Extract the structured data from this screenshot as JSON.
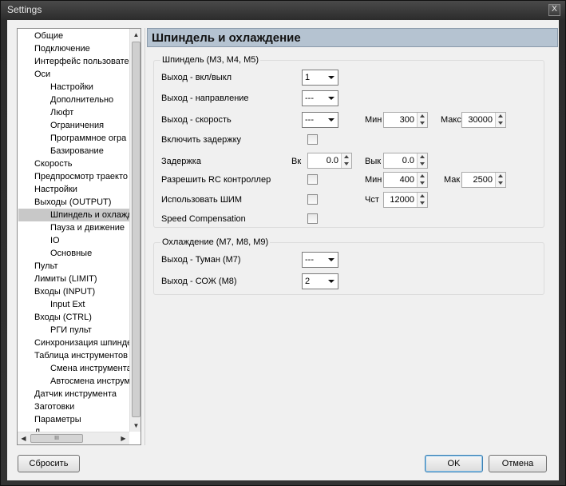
{
  "window": {
    "title": "Settings",
    "close_label": "X"
  },
  "tree": {
    "items": [
      {
        "label": "Общие",
        "level": 0
      },
      {
        "label": "Подключение",
        "level": 0
      },
      {
        "label": "Интерфейс пользовате",
        "level": 0
      },
      {
        "label": "Оси",
        "level": 0
      },
      {
        "label": "Настройки",
        "level": 1
      },
      {
        "label": "Дополнительно",
        "level": 1
      },
      {
        "label": "Люфт",
        "level": 1
      },
      {
        "label": "Ограничения",
        "level": 1
      },
      {
        "label": "Программное огра",
        "level": 1
      },
      {
        "label": "Базирование",
        "level": 1
      },
      {
        "label": "Скорость",
        "level": 0
      },
      {
        "label": "Предпросмотр траекто",
        "level": 0
      },
      {
        "label": "Настройки",
        "level": 0
      },
      {
        "label": "Выходы (OUTPUT)",
        "level": 0
      },
      {
        "label": "Шпиндель и охлажд",
        "level": 1,
        "selected": true
      },
      {
        "label": "Пауза и движение",
        "level": 1
      },
      {
        "label": "IO",
        "level": 1
      },
      {
        "label": "Основные",
        "level": 1
      },
      {
        "label": "Пульт",
        "level": 0
      },
      {
        "label": "Лимиты (LIMIT)",
        "level": 0
      },
      {
        "label": "Входы (INPUT)",
        "level": 0
      },
      {
        "label": "Input Ext",
        "level": 1
      },
      {
        "label": "Входы (CTRL)",
        "level": 0
      },
      {
        "label": "РГИ пульт",
        "level": 1
      },
      {
        "label": "Синхронизация шпинде",
        "level": 0
      },
      {
        "label": "Таблица инструментов",
        "level": 0
      },
      {
        "label": "Смена инструмента",
        "level": 1
      },
      {
        "label": "Автосмена инструм",
        "level": 1
      },
      {
        "label": "Датчик инструмента",
        "level": 0
      },
      {
        "label": "Заготовки",
        "level": 0
      },
      {
        "label": "Параметры",
        "level": 0
      },
      {
        "label": "Д",
        "level": 0
      }
    ],
    "hscroll_grip": "III"
  },
  "panel": {
    "title": "Шпиндель и охлаждение",
    "spindle": {
      "group_title": "Шпиндель (M3, M4, M5)",
      "out_onoff_label": "Выход - вкл/выкл",
      "out_onoff_value": "1",
      "out_dir_label": "Выход - направление",
      "out_dir_value": "---",
      "out_speed_label": "Выход - скорость",
      "out_speed_value": "---",
      "speed_min_label": "Мин",
      "speed_min_value": "300",
      "speed_max_label": "Макс",
      "speed_max_value": "30000",
      "enable_delay_label": "Включить задержку",
      "delay_label": "Задержка",
      "delay_on_label": "Вк",
      "delay_on_value": "0.0",
      "delay_off_label": "Вык",
      "delay_off_value": "0.0",
      "rc_label": "Разрешить RC контроллер",
      "rc_min_label": "Мин",
      "rc_min_value": "400",
      "rc_max_label": "Мак",
      "rc_max_value": "2500",
      "pwm_label": "Использовать ШИМ",
      "pwm_freq_label": "Чст",
      "pwm_freq_value": "12000",
      "speed_comp_label": "Speed Compensation"
    },
    "cooling": {
      "group_title": "Охлаждение (M7, M8, M9)",
      "mist_label": "Выход - Туман (M7)",
      "mist_value": "---",
      "flood_label": "Выход - СОЖ (M8)",
      "flood_value": "2"
    }
  },
  "buttons": {
    "reset": "Сбросить",
    "ok": "OK",
    "cancel": "Отмена"
  }
}
